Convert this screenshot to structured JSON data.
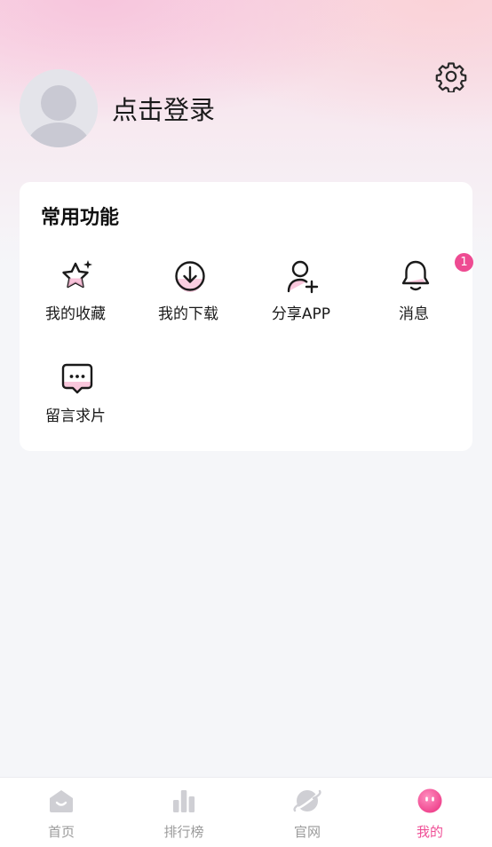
{
  "header": {
    "login_text": "点击登录"
  },
  "functions": {
    "title": "常用功能",
    "items": [
      {
        "label": "我的收藏",
        "icon": "star-sparkle-icon"
      },
      {
        "label": "我的下载",
        "icon": "download-icon"
      },
      {
        "label": "分享APP",
        "icon": "add-user-icon"
      },
      {
        "label": "消息",
        "icon": "bell-icon",
        "badge": "1"
      },
      {
        "label": "留言求片",
        "icon": "chat-bubble-icon"
      }
    ]
  },
  "tabbar": {
    "items": [
      {
        "label": "首页",
        "icon": "home-icon"
      },
      {
        "label": "排行榜",
        "icon": "ranking-icon"
      },
      {
        "label": "官网",
        "icon": "planet-icon"
      },
      {
        "label": "我的",
        "icon": "profile-face-icon",
        "active": true
      }
    ]
  },
  "colors": {
    "accent": "#ef4f96",
    "badge": "#ee4b92",
    "tab_inactive": "#9a9a9a"
  }
}
